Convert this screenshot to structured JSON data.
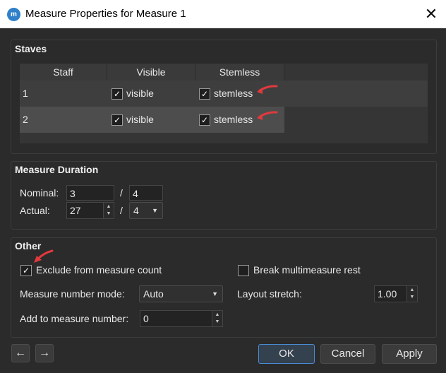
{
  "window": {
    "title": "Measure Properties for Measure 1",
    "close_glyph": "✕",
    "app_icon_glyph": "m"
  },
  "staves": {
    "heading": "Staves",
    "columns": [
      "Staff",
      "Visible",
      "Stemless"
    ],
    "rows": [
      {
        "staff": "1",
        "visible_label": "visible",
        "visible_checked": true,
        "stemless_label": "stemless",
        "stemless_checked": true
      },
      {
        "staff": "2",
        "visible_label": "visible",
        "visible_checked": true,
        "stemless_label": "stemless",
        "stemless_checked": true
      }
    ]
  },
  "duration": {
    "heading": "Measure Duration",
    "nominal_label": "Nominal:",
    "nominal_num": "3",
    "nominal_den": "4",
    "actual_label": "Actual:",
    "actual_num": "27",
    "actual_den": "4",
    "slash": "/"
  },
  "other": {
    "heading": "Other",
    "exclude_label": "Exclude from measure count",
    "exclude_checked": true,
    "break_label": "Break multimeasure rest",
    "break_checked": false,
    "mode_label": "Measure number mode:",
    "mode_value": "Auto",
    "stretch_label": "Layout stretch:",
    "stretch_value": "1.00",
    "add_label": "Add to measure number:",
    "add_value": "0"
  },
  "buttons": {
    "prev_glyph": "←",
    "next_glyph": "→",
    "ok": "OK",
    "cancel": "Cancel",
    "apply": "Apply"
  },
  "colors": {
    "annotation_arrow": "#e0393e",
    "accent_border": "#4a8cd6"
  }
}
